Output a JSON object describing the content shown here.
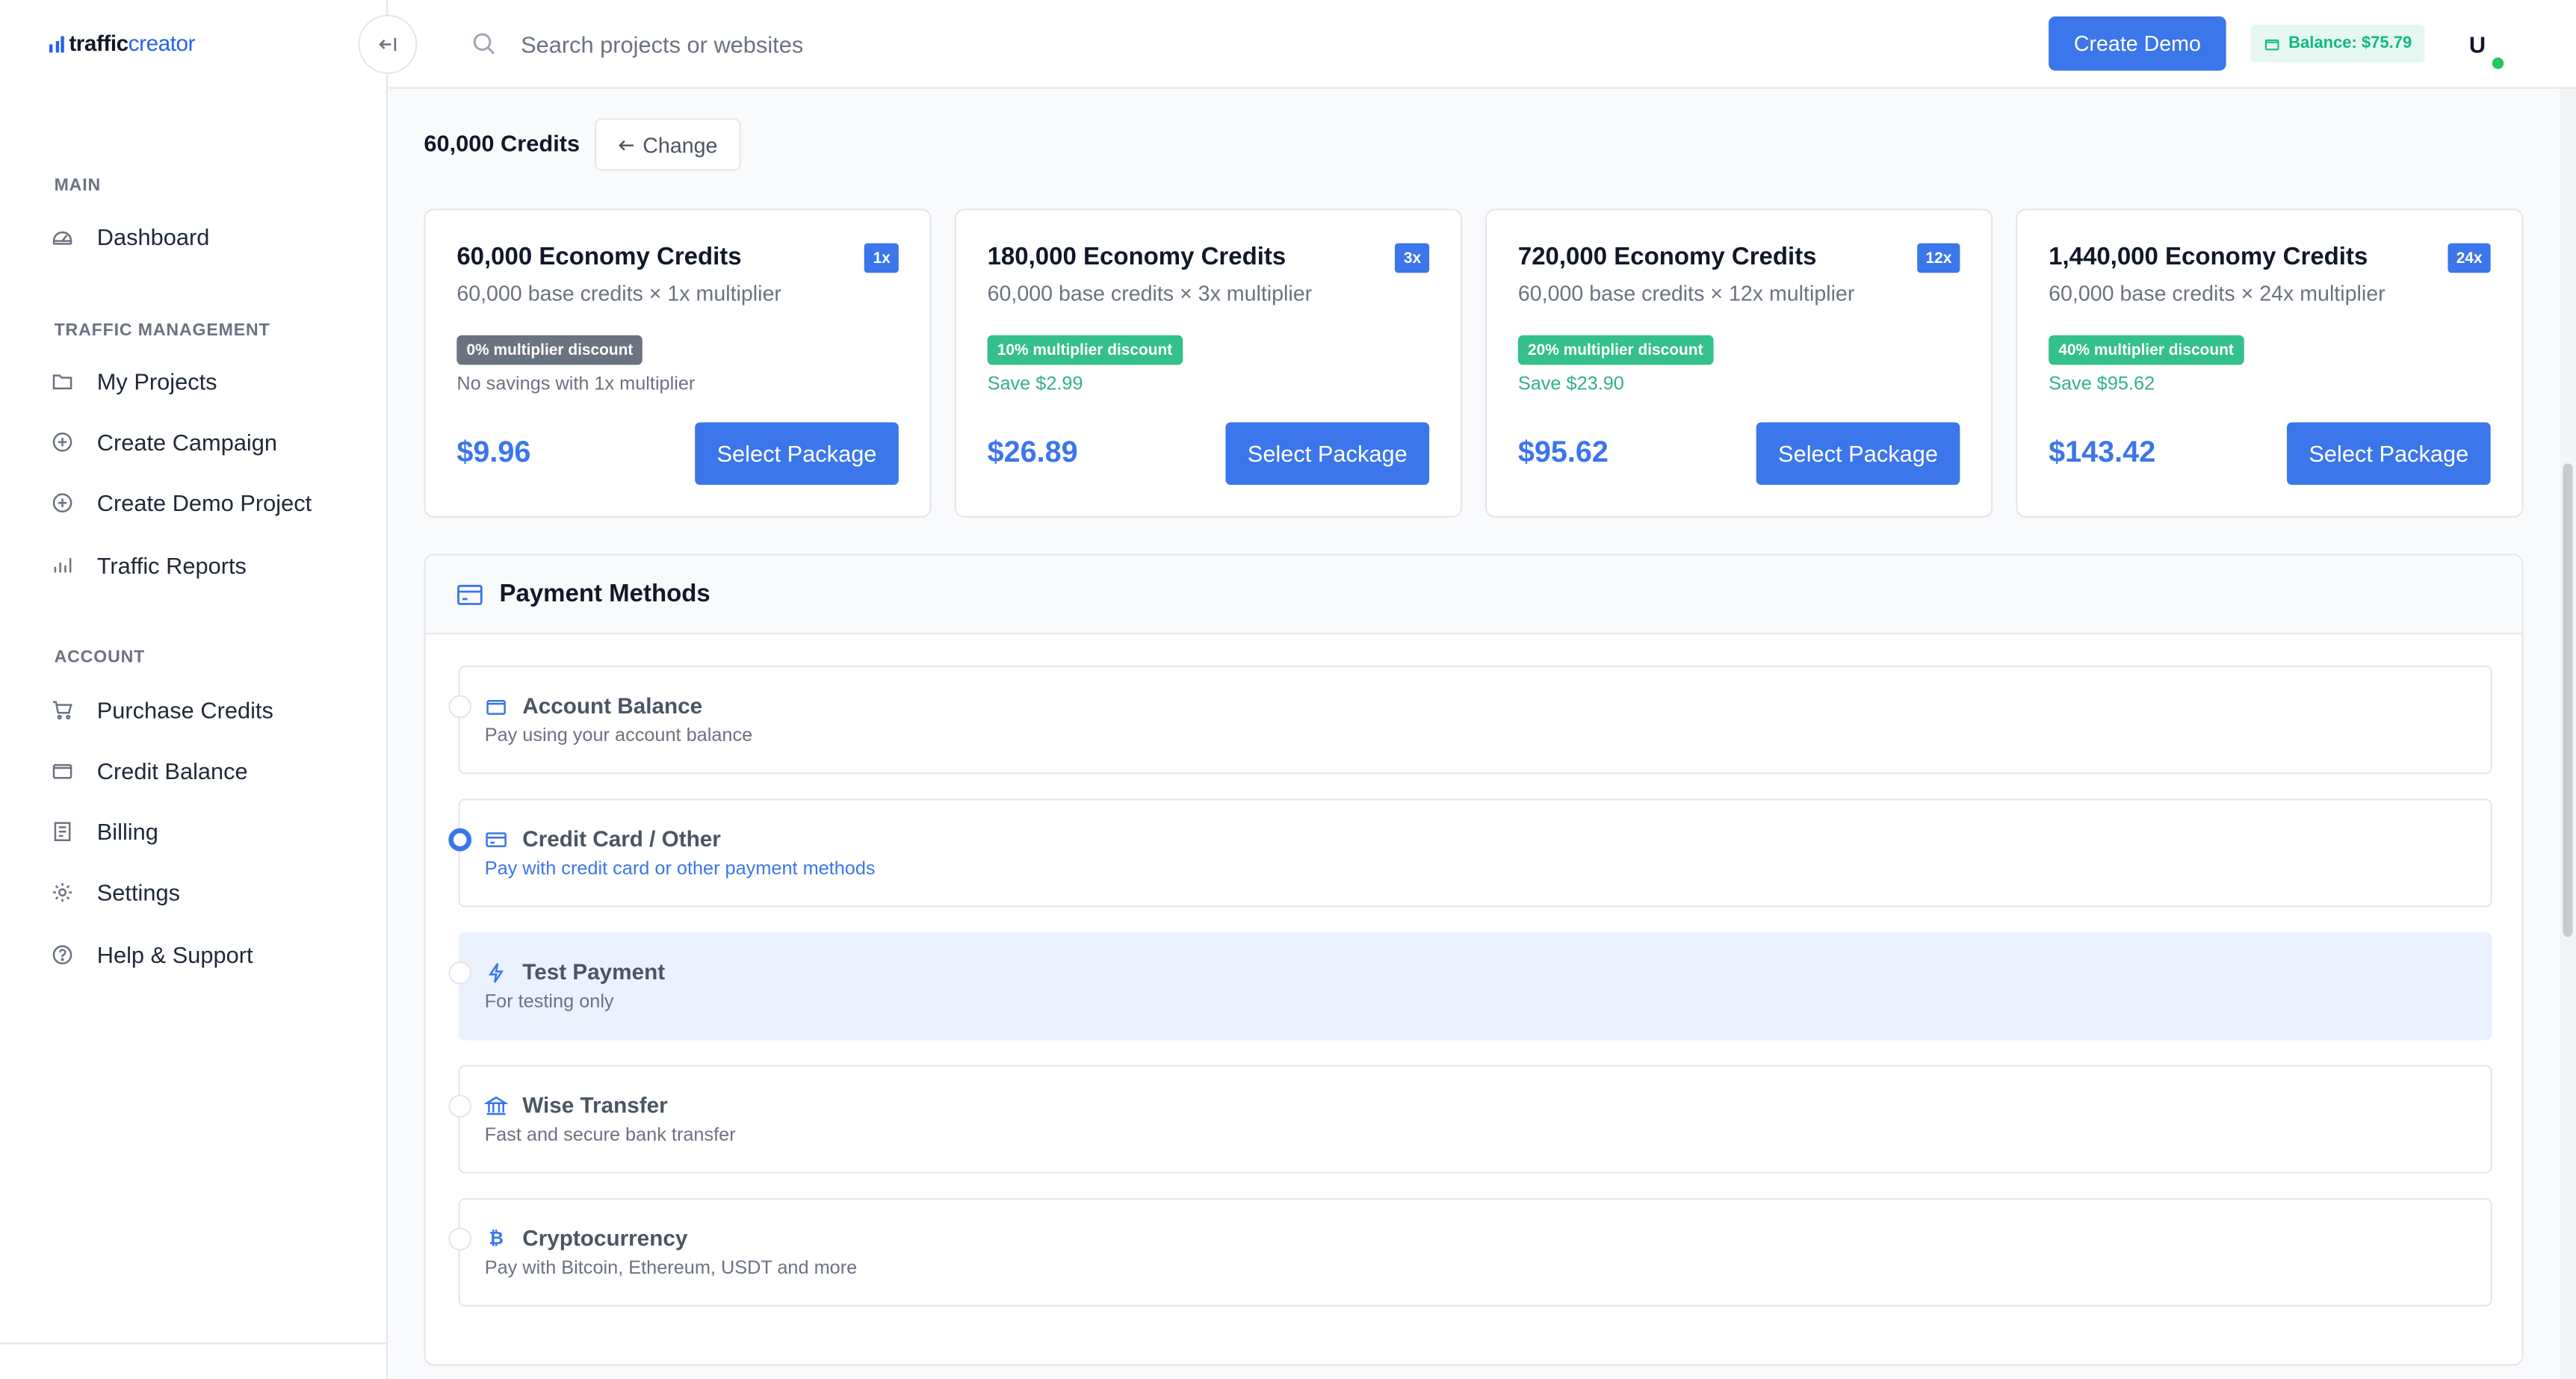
{
  "brand": {
    "name_bold": "traffic",
    "name_light": "creator"
  },
  "sidebar": {
    "sections": [
      {
        "label": "MAIN",
        "items": [
          {
            "label": "Dashboard",
            "icon": "dashboard-icon"
          }
        ]
      },
      {
        "label": "TRAFFIC MANAGEMENT",
        "items": [
          {
            "label": "My Projects",
            "icon": "folder-icon"
          },
          {
            "label": "Create Campaign",
            "icon": "plus-circle-icon"
          },
          {
            "label": "Create Demo Project",
            "icon": "plus-circle-icon"
          },
          {
            "label": "Traffic Reports",
            "icon": "bar-chart-icon"
          }
        ]
      },
      {
        "label": "ACCOUNT",
        "items": [
          {
            "label": "Purchase Credits",
            "icon": "cart-icon"
          },
          {
            "label": "Credit Balance",
            "icon": "wallet-icon"
          },
          {
            "label": "Billing",
            "icon": "receipt-icon"
          },
          {
            "label": "Settings",
            "icon": "gear-icon"
          },
          {
            "label": "Help & Support",
            "icon": "help-icon"
          }
        ]
      }
    ]
  },
  "header": {
    "search_placeholder": "Search projects or websites",
    "create_demo_label": "Create Demo",
    "balance_label": "Balance: $75.79",
    "avatar_initial": "U"
  },
  "credits_bar": {
    "selected": "60,000 Credits",
    "change_label": "Change"
  },
  "packages": [
    {
      "title": "60,000 Economy Credits",
      "multiplier": "1x",
      "subtitle": "60,000 base credits × 1x multiplier",
      "discount": "0% multiplier discount",
      "savings": "No savings with 1x multiplier",
      "price": "$9.96",
      "button": "Select Package"
    },
    {
      "title": "180,000 Economy Credits",
      "multiplier": "3x",
      "subtitle": "60,000 base credits × 3x multiplier",
      "discount": "10% multiplier discount",
      "savings": "Save $2.99",
      "price": "$26.89",
      "button": "Select Package"
    },
    {
      "title": "720,000 Economy Credits",
      "multiplier": "12x",
      "subtitle": "60,000 base credits × 12x multiplier",
      "discount": "20% multiplier discount",
      "savings": "Save $23.90",
      "price": "$95.62",
      "button": "Select Package"
    },
    {
      "title": "1,440,000 Economy Credits",
      "multiplier": "24x",
      "subtitle": "60,000 base credits × 24x multiplier",
      "discount": "40% multiplier discount",
      "savings": "Save $95.62",
      "price": "$143.42",
      "button": "Select Package"
    }
  ],
  "payment": {
    "title": "Payment Methods",
    "options": [
      {
        "title": "Account Balance",
        "desc": "Pay using your account balance",
        "icon": "wallet-icon",
        "selected": false
      },
      {
        "title": "Credit Card / Other",
        "desc": "Pay with credit card or other payment methods",
        "icon": "credit-card-icon",
        "selected": true
      },
      {
        "title": "Test Payment",
        "desc": "For testing only",
        "icon": "bolt-icon",
        "selected": false
      },
      {
        "title": "Wise Transfer",
        "desc": "Fast and secure bank transfer",
        "icon": "bank-icon",
        "selected": false
      },
      {
        "title": "Cryptocurrency",
        "desc": "Pay with Bitcoin, Ethereum, USDT and more",
        "icon": "bitcoin-icon",
        "selected": false
      }
    ]
  },
  "colors": {
    "primary": "#3b76ea",
    "success": "#34c08a",
    "muted": "#6b7280"
  }
}
